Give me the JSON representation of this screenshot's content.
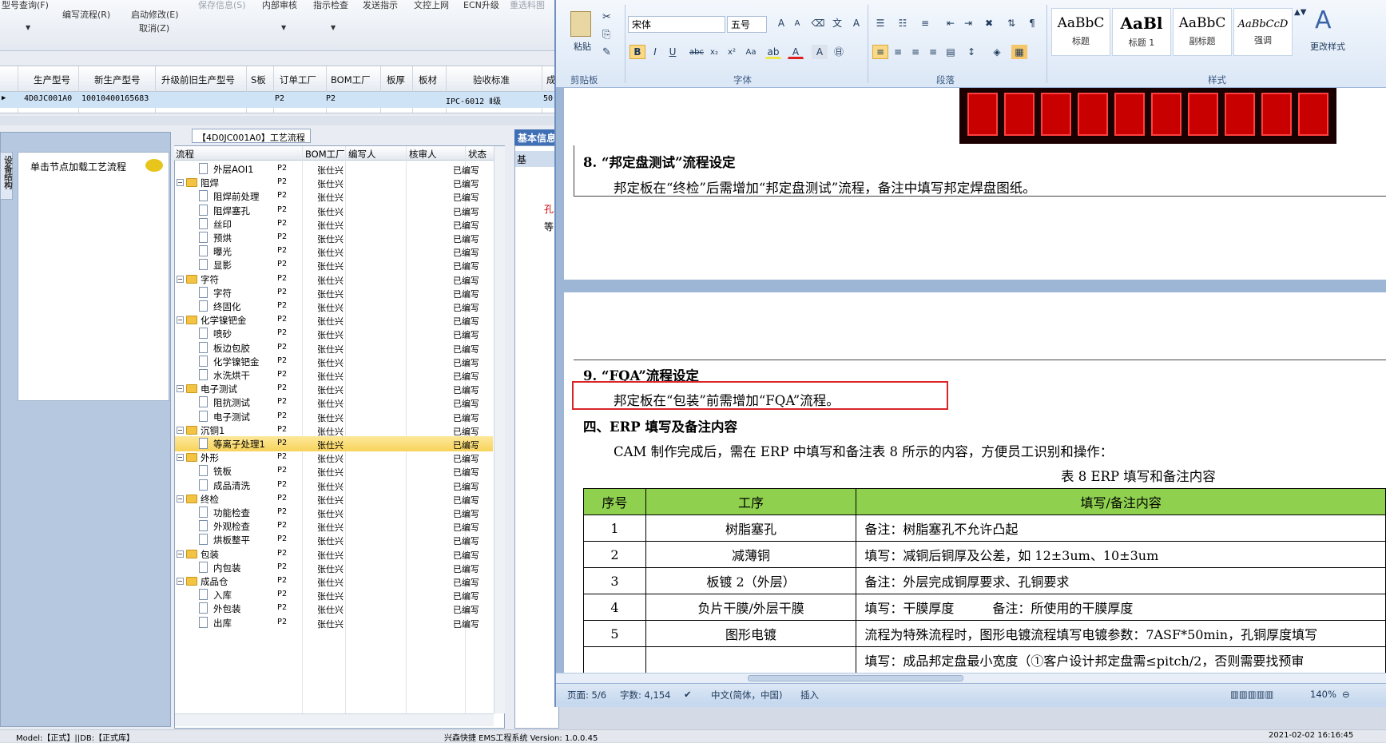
{
  "erp": {
    "toolbar": {
      "items": [
        "型号查询(F)",
        "编写流程(R)",
        "启动修改(E)",
        "保存信息(S)",
        "内部审核",
        "指示检查",
        "发送指示",
        "文控上网",
        "ECN升级",
        "重选料图"
      ],
      "cancel": "取消(Z)"
    },
    "grid": {
      "headers": [
        "生产型号",
        "新生产型号",
        "升级前旧生产型号",
        "S板",
        "订单工厂",
        "BOM工厂",
        "板厚",
        "板材",
        "验收标准",
        "成"
      ],
      "row": {
        "prod": "4D0JC001A0",
        "newprod": "10010400165683",
        "order_factory": "P2",
        "bom_factory": "P2",
        "standard": "IPC-6012 Ⅱ级",
        "extra": "50."
      }
    },
    "left_panel": {
      "vtab": "设备结构",
      "click_label": "单击节点加载工艺流程"
    },
    "tree": {
      "title": "【4D0JC001A0】工艺流程",
      "headers": [
        "流程",
        "BOM工厂",
        "编写人",
        "核审人",
        "状态"
      ],
      "rows": [
        {
          "name": "外层AOI1",
          "type": "doc",
          "level": 2,
          "bom": "P2",
          "user": "张仕兴",
          "status": "已编写"
        },
        {
          "name": "阻焊",
          "type": "folder",
          "level": 1,
          "bom": "P2",
          "user": "张仕兴",
          "status": "已编写"
        },
        {
          "name": "阻焊前处理",
          "type": "doc",
          "level": 2,
          "bom": "P2",
          "user": "张仕兴",
          "status": "已编写"
        },
        {
          "name": "阻焊塞孔",
          "type": "doc",
          "level": 2,
          "bom": "P2",
          "user": "张仕兴",
          "status": "已编写"
        },
        {
          "name": "丝印",
          "type": "doc",
          "level": 2,
          "bom": "P2",
          "user": "张仕兴",
          "status": "已编写"
        },
        {
          "name": "预烘",
          "type": "doc",
          "level": 2,
          "bom": "P2",
          "user": "张仕兴",
          "status": "已编写"
        },
        {
          "name": "曝光",
          "type": "doc",
          "level": 2,
          "bom": "P2",
          "user": "张仕兴",
          "status": "已编写"
        },
        {
          "name": "显影",
          "type": "doc",
          "level": 2,
          "bom": "P2",
          "user": "张仕兴",
          "status": "已编写"
        },
        {
          "name": "字符",
          "type": "folder",
          "level": 1,
          "bom": "P2",
          "user": "张仕兴",
          "status": "已编写"
        },
        {
          "name": "字符",
          "type": "doc",
          "level": 2,
          "bom": "P2",
          "user": "张仕兴",
          "status": "已编写"
        },
        {
          "name": "终固化",
          "type": "doc",
          "level": 2,
          "bom": "P2",
          "user": "张仕兴",
          "status": "已编写"
        },
        {
          "name": "化学镍钯金",
          "type": "folder",
          "level": 1,
          "bom": "P2",
          "user": "张仕兴",
          "status": "已编写"
        },
        {
          "name": "喷砂",
          "type": "doc",
          "level": 2,
          "bom": "P2",
          "user": "张仕兴",
          "status": "已编写"
        },
        {
          "name": "板边包胶",
          "type": "doc",
          "level": 2,
          "bom": "P2",
          "user": "张仕兴",
          "status": "已编写"
        },
        {
          "name": "化学镍钯金",
          "type": "doc",
          "level": 2,
          "bom": "P2",
          "user": "张仕兴",
          "status": "已编写"
        },
        {
          "name": "水洗烘干",
          "type": "doc",
          "level": 2,
          "bom": "P2",
          "user": "张仕兴",
          "status": "已编写"
        },
        {
          "name": "电子测试",
          "type": "folder",
          "level": 1,
          "bom": "P2",
          "user": "张仕兴",
          "status": "已编写"
        },
        {
          "name": "阻抗测试",
          "type": "doc",
          "level": 2,
          "bom": "P2",
          "user": "张仕兴",
          "status": "已编写"
        },
        {
          "name": "电子测试",
          "type": "doc",
          "level": 2,
          "bom": "P2",
          "user": "张仕兴",
          "status": "已编写"
        },
        {
          "name": "沉铜1",
          "type": "folder",
          "level": 1,
          "bom": "P2",
          "user": "张仕兴",
          "status": "已编写"
        },
        {
          "name": "等离子处理1",
          "type": "doc",
          "level": 2,
          "bom": "P2",
          "user": "张仕兴",
          "status": "已编写",
          "selected": true
        },
        {
          "name": "外形",
          "type": "folder",
          "level": 1,
          "bom": "P2",
          "user": "张仕兴",
          "status": "已编写"
        },
        {
          "name": "铣板",
          "type": "doc",
          "level": 2,
          "bom": "P2",
          "user": "张仕兴",
          "status": "已编写"
        },
        {
          "name": "成品清洗",
          "type": "doc",
          "level": 2,
          "bom": "P2",
          "user": "张仕兴",
          "status": "已编写"
        },
        {
          "name": "终检",
          "type": "folder",
          "level": 1,
          "bom": "P2",
          "user": "张仕兴",
          "status": "已编写"
        },
        {
          "name": "功能检查",
          "type": "doc",
          "level": 2,
          "bom": "P2",
          "user": "张仕兴",
          "status": "已编写"
        },
        {
          "name": "外观检查",
          "type": "doc",
          "level": 2,
          "bom": "P2",
          "user": "张仕兴",
          "status": "已编写"
        },
        {
          "name": "烘板整平",
          "type": "doc",
          "level": 2,
          "bom": "P2",
          "user": "张仕兴",
          "status": "已编写"
        },
        {
          "name": "包装",
          "type": "folder",
          "level": 1,
          "bom": "P2",
          "user": "张仕兴",
          "status": "已编写"
        },
        {
          "name": "内包装",
          "type": "doc",
          "level": 2,
          "bom": "P2",
          "user": "张仕兴",
          "status": "已编写"
        },
        {
          "name": "成品仓",
          "type": "folder",
          "level": 1,
          "bom": "P2",
          "user": "张仕兴",
          "status": "已编写"
        },
        {
          "name": "入库",
          "type": "doc",
          "level": 2,
          "bom": "P2",
          "user": "张仕兴",
          "status": "已编写"
        },
        {
          "name": "外包装",
          "type": "doc",
          "level": 2,
          "bom": "P2",
          "user": "张仕兴",
          "status": "已编写"
        },
        {
          "name": "出库",
          "type": "doc",
          "level": 2,
          "bom": "P2",
          "user": "张仕兴",
          "status": "已编写"
        }
      ]
    },
    "basic_tab": "基本信息",
    "basic_sub": [
      "基",
      "孔",
      "等"
    ],
    "status": {
      "left": "Model:【正式】||DB:【正式库】",
      "center": "兴森快捷 EMS工程系统 Version: 1.0.0.45",
      "right": "2021-02-02 16:16:45"
    }
  },
  "word": {
    "ribbon": {
      "paste": "粘贴",
      "font_name": "宋体",
      "font_size": "五号",
      "groups": [
        "剪贴板",
        "字体",
        "段落",
        "样式"
      ],
      "styles": [
        {
          "preview": "AaBbC",
          "name": "标题"
        },
        {
          "preview": "AaBl",
          "name": "标题 1"
        },
        {
          "preview": "AaBbC",
          "name": "副标题"
        },
        {
          "preview": "AaBbCcD",
          "name": "强调"
        }
      ],
      "change_styles": "更改样式"
    },
    "doc": {
      "h8": "8. “邦定盘测试”流程设定",
      "p8": "邦定板在“终检”后需增加“邦定盘测试”流程，备注中填写邦定焊盘图纸。",
      "h9": "9. “FQA”流程设定",
      "p9": "邦定板在“包装”前需增加“FQA”流程。",
      "h4": "四、ERP 填写及备注内容",
      "p4": "CAM 制作完成后，需在 ERP 中填写和备注表 8 所示的内容，方便员工识别和操作：",
      "caption": "表 8 ERP 填写和备注内容",
      "table": {
        "headers": [
          "序号",
          "工序",
          "填写/备注内容"
        ],
        "rows": [
          [
            "1",
            "树脂塞孔",
            "备注：树脂塞孔不允许凸起"
          ],
          [
            "2",
            "减薄铜",
            "填写：减铜后铜厚及公差，如 12±3um、10±3um"
          ],
          [
            "3",
            "板镀 2（外层）",
            "备注：外层完成铜厚要求、孔铜要求"
          ],
          [
            "4",
            "负片干膜/外层干膜",
            "填写：干膜厚度　　　备注：所使用的干膜厚度"
          ],
          [
            "5",
            "图形电镀",
            "流程为特殊流程时，图形电镀流程填写电镀参数：7ASF*50min，孔铜厚度填写"
          ],
          [
            "",
            "",
            "填写：成品邦定盘最小宽度（①客户设计邦定盘需≤pitch/2，否则需要找预审"
          ]
        ]
      }
    },
    "status": {
      "page": "页面: 5/6",
      "words": "字数: 4,154",
      "lang": "中文(简体，中国)",
      "mode": "插入",
      "zoom": "140%"
    }
  }
}
